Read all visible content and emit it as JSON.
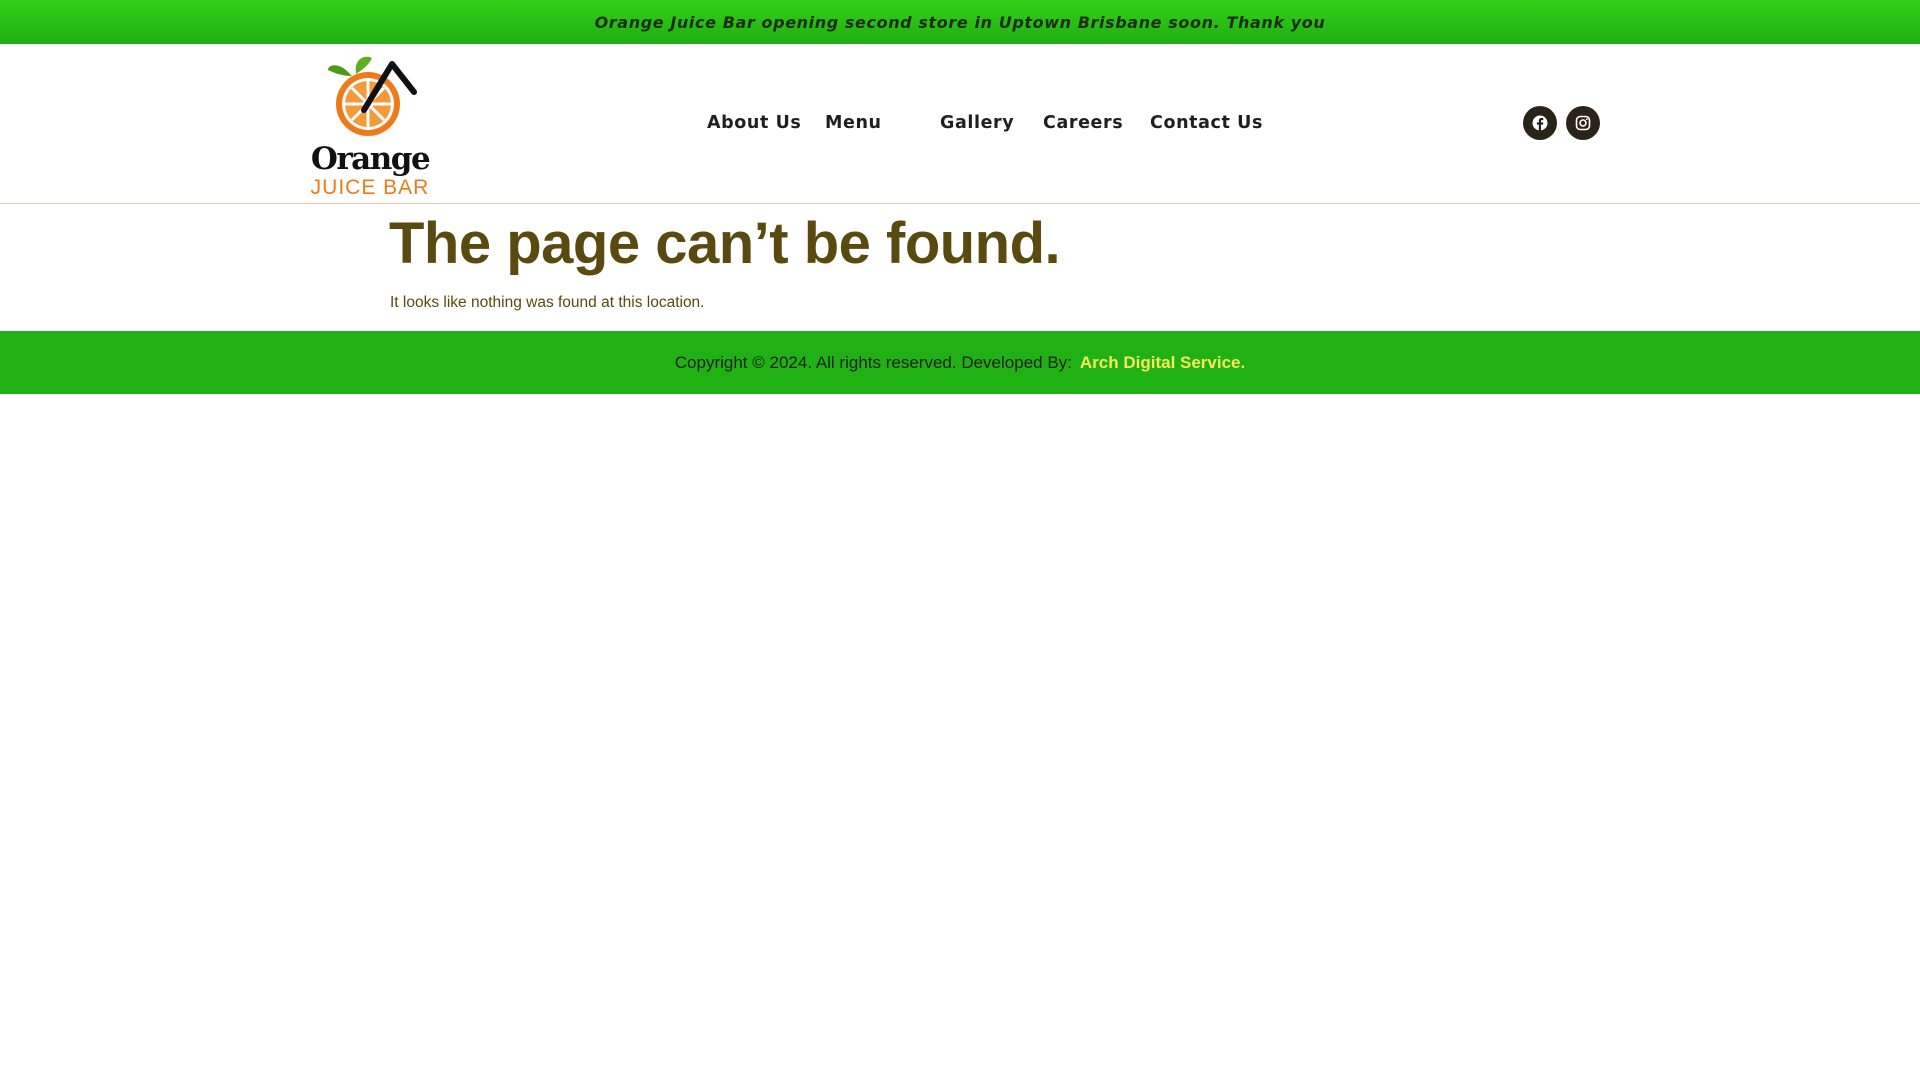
{
  "announcement": {
    "text": "Orange Juice Bar opening second store in Uptown Brisbane soon. Thank you"
  },
  "logo": {
    "word": "Orange",
    "subtitle": "JUICE BAR",
    "icon": "orange-slice-with-straw-icon"
  },
  "nav": {
    "items": [
      {
        "label": "About Us"
      },
      {
        "label": "Menu"
      },
      {
        "label": "Gallery"
      },
      {
        "label": "Careers"
      },
      {
        "label": "Contact Us"
      }
    ]
  },
  "social": {
    "facebook_icon": "facebook-icon",
    "instagram_icon": "instagram-icon"
  },
  "content": {
    "title": "The page can’t be found.",
    "description": "It looks like nothing was found at this location."
  },
  "footer": {
    "copyright": "Copyright © 2024. All rights reserved. Developed By:",
    "developer_link": "Arch Digital Service."
  },
  "colors": {
    "announcement_green": "#2fc818",
    "footer_green": "#20b114",
    "brand_orange": "#ef7a1a",
    "title_olive": "#5a4a10",
    "link_yellow": "#f6ea5a",
    "social_dark": "#2a2418"
  }
}
